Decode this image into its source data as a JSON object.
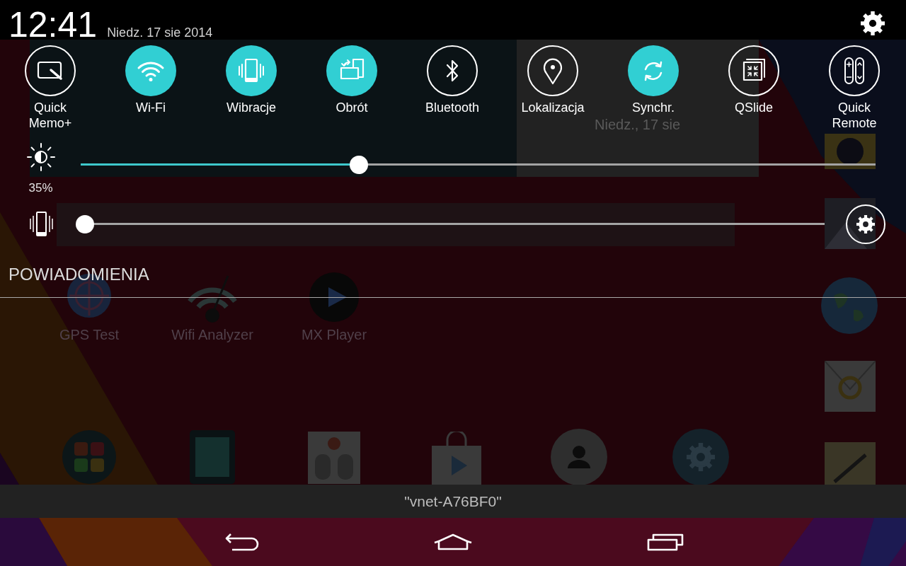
{
  "status_bar": {
    "time": "12:41",
    "date": "Niedz. 17 sie 2014"
  },
  "quick_settings": [
    {
      "label": "Quick Memo+",
      "on": false
    },
    {
      "label": "Wi-Fi",
      "on": true
    },
    {
      "label": "Wibracje",
      "on": true
    },
    {
      "label": "Obrót",
      "on": true
    },
    {
      "label": "Bluetooth",
      "on": false
    },
    {
      "label": "Lokalizacja",
      "on": false
    },
    {
      "label": "Synchr.",
      "on": true
    },
    {
      "label": "QSlide",
      "on": false
    },
    {
      "label": "Quick Remote",
      "on": false
    }
  ],
  "brightness": {
    "level": 0.35,
    "reading": "35%"
  },
  "vibration": {
    "level": 0
  },
  "notifications": {
    "title": "POWIADOMIENIA"
  },
  "toast": {
    "text": "\"vnet-A76BF0\""
  },
  "home_screen": {
    "clock_widget": {
      "date": "Niedz., 17 sie"
    },
    "apps": [
      {
        "label": "GPS Test"
      },
      {
        "label": "Wifi Analyzer"
      },
      {
        "label": "MX Player"
      }
    ]
  }
}
